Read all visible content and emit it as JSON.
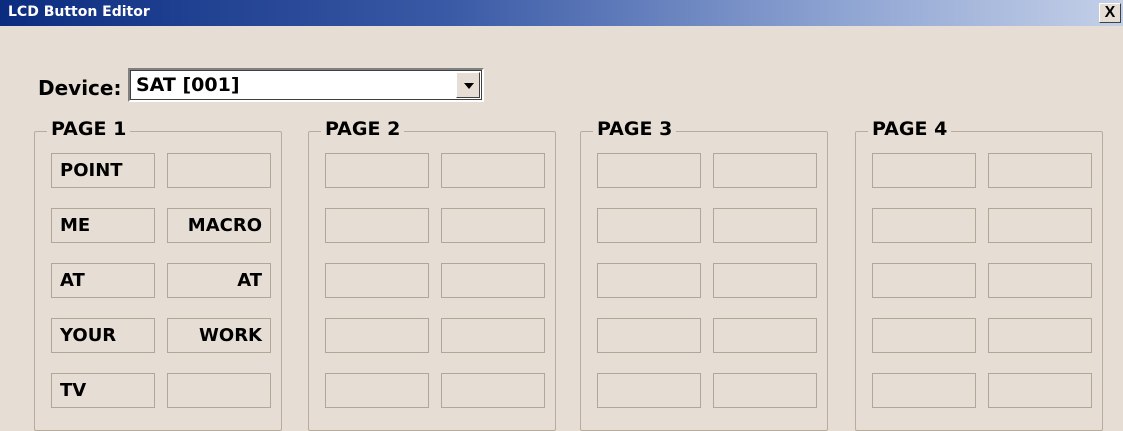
{
  "window": {
    "title": "LCD Button Editor",
    "close_label": "X"
  },
  "device": {
    "label": "Device:",
    "value": "SAT [001]"
  },
  "pages": [
    {
      "label": "PAGE 1",
      "buttons": [
        "POINT",
        "",
        "ME",
        "MACRO",
        "AT",
        "AT",
        "YOUR",
        "WORK",
        "TV",
        ""
      ]
    },
    {
      "label": "PAGE 2",
      "buttons": [
        "",
        "",
        "",
        "",
        "",
        "",
        "",
        "",
        "",
        ""
      ]
    },
    {
      "label": "PAGE 3",
      "buttons": [
        "",
        "",
        "",
        "",
        "",
        "",
        "",
        "",
        "",
        ""
      ]
    },
    {
      "label": "PAGE 4",
      "buttons": [
        "",
        "",
        "",
        "",
        "",
        "",
        "",
        "",
        "",
        ""
      ]
    }
  ]
}
